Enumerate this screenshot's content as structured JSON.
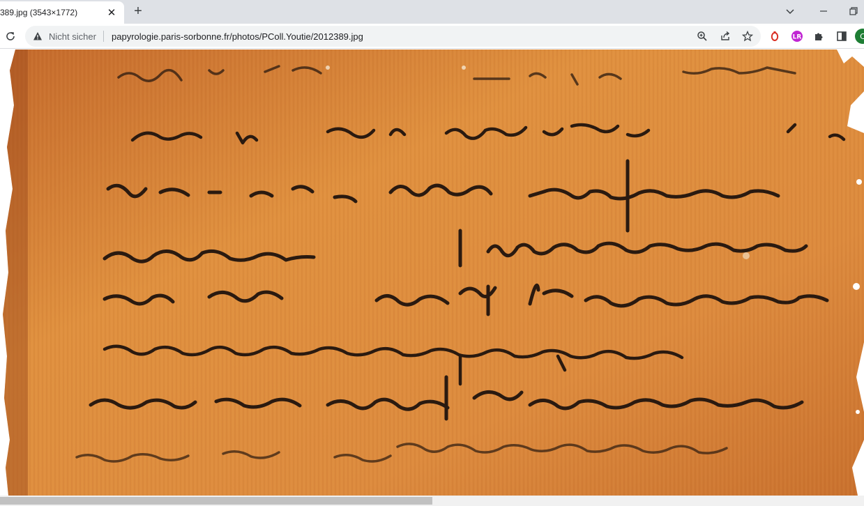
{
  "tab": {
    "title": "389.jpg (3543×1772)",
    "close_glyph": "✕"
  },
  "new_tab_glyph": "+",
  "toolbar": {
    "security_text": "Nicht sicher",
    "url": "papyrologie.paris-sorbonne.fr/photos/PColl.Youtie/2012389.jpg"
  },
  "icons": {
    "reload": "reload-icon",
    "warning": "warning-icon",
    "zoom": "zoom-icon",
    "share": "share-icon",
    "bookmark": "star-icon",
    "extension_red": "extension-icon",
    "extension_purple": "extension-icon",
    "extensions": "puzzle-icon",
    "sidepanel": "sidepanel-icon",
    "profile": "avatar"
  },
  "colors": {
    "papyrus": "#d9873f",
    "ink": "#2a1a10",
    "profile_avatar": "#1e7e34",
    "ext_red": "#d93025",
    "ext_purple": "#c026d3"
  },
  "image": {
    "description_alt": "2012389.jpg"
  }
}
